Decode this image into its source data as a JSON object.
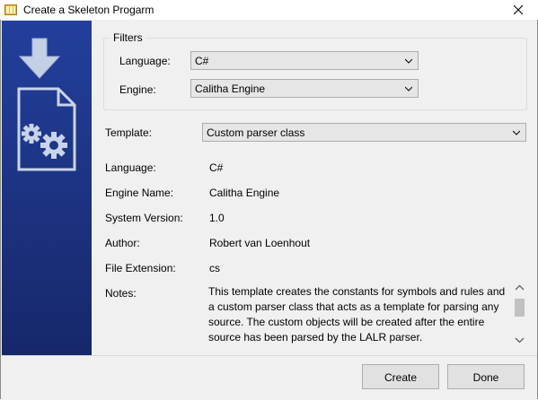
{
  "window": {
    "title": "Create a Skeleton Progarm",
    "app_icon": "folder-icon",
    "close_icon": "close-icon"
  },
  "sidebar": {
    "icon": "download-document-gears-icon",
    "accent": "#1e3688"
  },
  "filters": {
    "legend": "Filters",
    "language_label": "Language:",
    "language_value": "C#",
    "engine_label": "Engine:",
    "engine_value": "Calitha Engine"
  },
  "template": {
    "label": "Template:",
    "value": "Custom parser class"
  },
  "details": {
    "language_label": "Language:",
    "language_value": "C#",
    "engine_name_label": "Engine Name:",
    "engine_name_value": "Calitha Engine",
    "system_version_label": "System Version:",
    "system_version_value": "1.0",
    "author_label": "Author:",
    "author_value": "Robert van Loenhout",
    "file_extension_label": "File Extension:",
    "file_extension_value": "cs",
    "notes_label": "Notes:",
    "notes_value": "This template creates the constants for symbols and rules and a custom parser class that acts as a template for parsing any source. The custom objects will be created after the entire source has been parsed by the LALR parser."
  },
  "buttons": {
    "create_label": "Create",
    "done_label": "Done"
  }
}
